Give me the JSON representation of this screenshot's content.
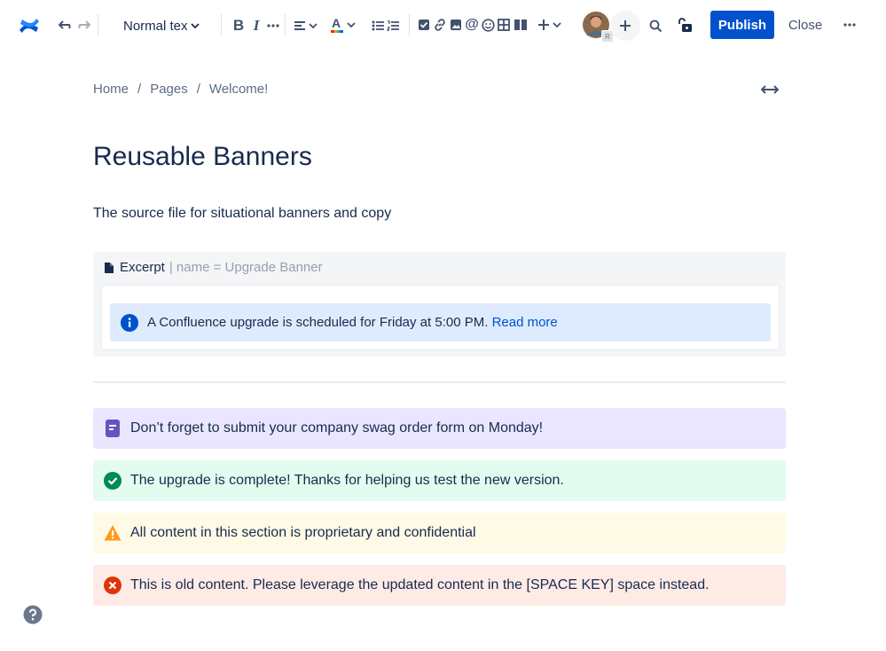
{
  "toolbar": {
    "text_style": "Normal tex",
    "publish_label": "Publish",
    "close_label": "Close",
    "avatar_badge": "R"
  },
  "breadcrumb": {
    "items": [
      "Home",
      "Pages",
      "Welcome!"
    ],
    "separator": "/"
  },
  "page": {
    "title": "Reusable Banners",
    "subtitle": "The source file for situational banners and copy"
  },
  "excerpt": {
    "label": "Excerpt",
    "meta": "| name = Upgrade Banner",
    "info_text": "A Confluence upgrade is scheduled for Friday at 5:00 PM.",
    "info_link": "Read more"
  },
  "panels": [
    {
      "type": "note",
      "text": "Don’t forget to submit your company swag order form on Monday!",
      "bg": "#eae6ff",
      "icon_color": "#6554c0"
    },
    {
      "type": "success",
      "text": "The upgrade is complete! Thanks for helping us test the new version.",
      "bg": "#e3fcef",
      "icon_color": "#00875a"
    },
    {
      "type": "warning",
      "text": "All content in this section is proprietary and confidential",
      "bg": "#fffae6",
      "icon_color": "#ff991f"
    },
    {
      "type": "error",
      "text": "This is old content. Please leverage the updated content in the [SPACE KEY] space instead.",
      "bg": "#ffebe6",
      "icon_color": "#de350b"
    }
  ],
  "colors": {
    "brand": "#0052cc",
    "info_bg": "#deebff",
    "info_icon": "#0052cc"
  }
}
